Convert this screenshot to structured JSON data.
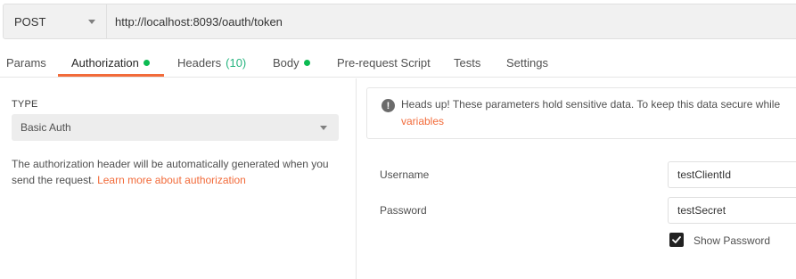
{
  "request": {
    "method": "POST",
    "url": "http://localhost:8093/oauth/token"
  },
  "tabs": [
    {
      "label": "Params"
    },
    {
      "label": "Authorization",
      "dot": true,
      "active": true
    },
    {
      "label": "Headers",
      "count": "(10)"
    },
    {
      "label": "Body",
      "dot": true
    },
    {
      "label": "Pre-request Script"
    },
    {
      "label": "Tests"
    },
    {
      "label": "Settings"
    }
  ],
  "auth": {
    "type_label": "TYPE",
    "type_value": "Basic Auth",
    "help_text": "The authorization header will be automatically generated when you send the request.",
    "help_link": "Learn more about authorization"
  },
  "alert": {
    "text": "Heads up! These parameters hold sensitive data. To keep this data secure while",
    "link": "variables"
  },
  "fields": {
    "username_label": "Username",
    "username_value": "testClientId",
    "password_label": "Password",
    "password_value": "testSecret",
    "show_password_label": "Show Password",
    "show_password_checked": true
  },
  "colors": {
    "accent": "#f26b3a",
    "status_dot": "#0cbb52",
    "count": "#26b47f"
  },
  "icons": {
    "method_caret": "chevron-down-icon",
    "type_caret": "chevron-down-icon",
    "alert": "info-icon",
    "checkbox": "check-icon"
  }
}
